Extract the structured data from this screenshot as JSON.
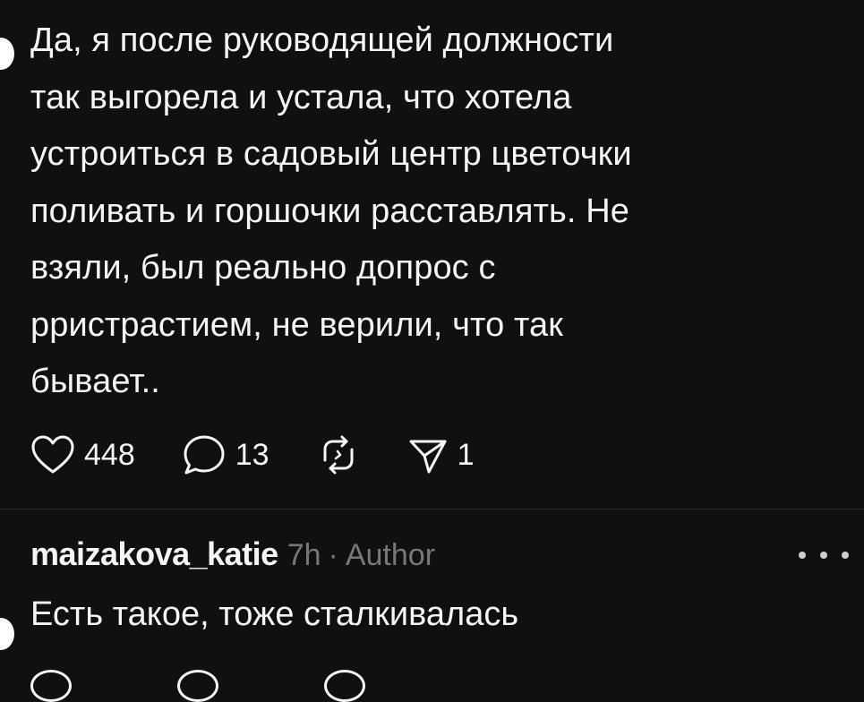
{
  "post": {
    "text": "Да, я после руководящей должности\nтак выгорела и устала, что хотела\nустроиться в садовый центр цветочки\nполивать и горшочки расставлять. Не\nвзяли, был реально допрос с\npристрастием, не верили, что так\nбывает..",
    "likes": "448",
    "comments": "13",
    "shares": "1",
    "icons": {
      "like": "heart-icon",
      "comment": "speech-bubble-icon",
      "repost": "repost-icon",
      "share": "send-icon"
    }
  },
  "reply": {
    "username": "maizakova_katie",
    "time": "7h",
    "separator": "·",
    "badge": "Author",
    "text": "Есть такое, тоже сталкивалась",
    "more_icon": "more-dots-icon"
  },
  "colors": {
    "background": "#101010",
    "text": "#f3f5f7",
    "muted": "#777777"
  }
}
